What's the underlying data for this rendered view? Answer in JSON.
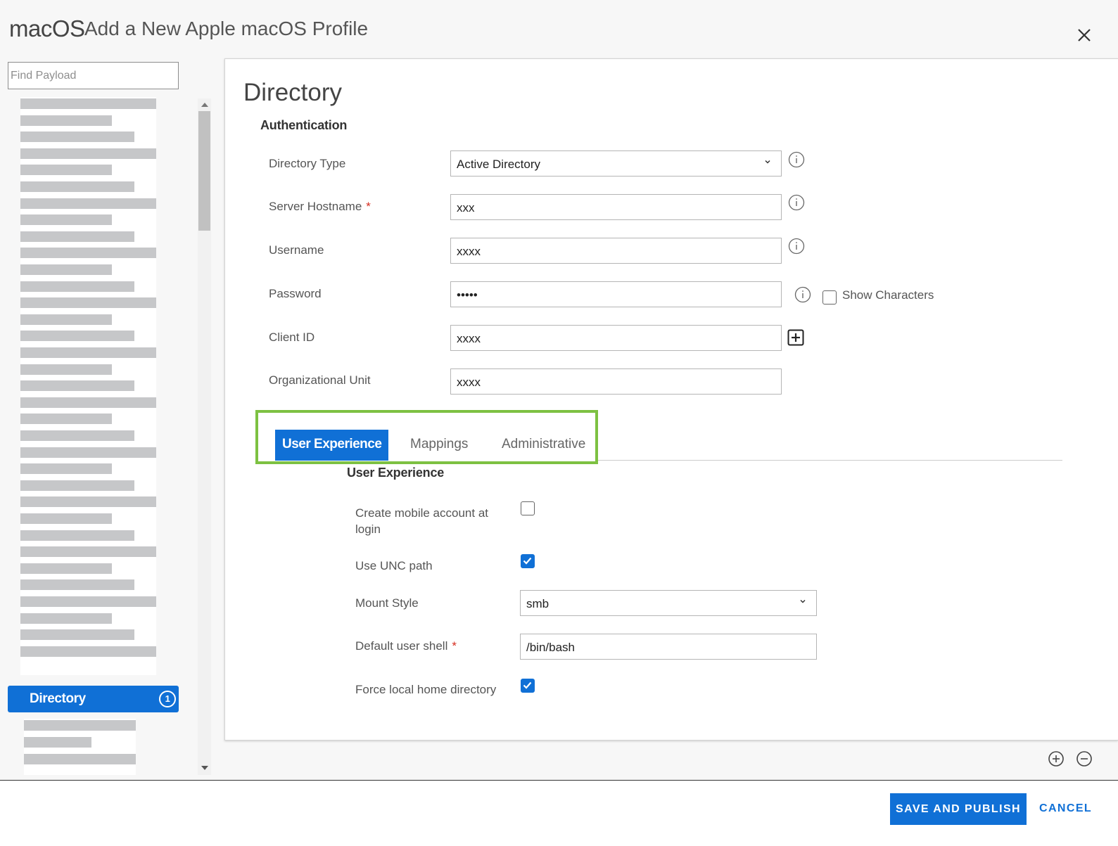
{
  "header": {
    "brand": "macOS",
    "title": "Add a New Apple macOS Profile",
    "close_icon": "close-icon"
  },
  "sidebar": {
    "search_placeholder": "Find Payload",
    "active_item": {
      "label": "Directory",
      "badge": "1"
    }
  },
  "panel": {
    "title": "Directory",
    "section": "Authentication",
    "fields": {
      "directory_type": {
        "label": "Directory Type",
        "value": "Active Directory"
      },
      "server_hostname": {
        "label": "Server Hostname",
        "required": "*",
        "value": "xxx"
      },
      "username": {
        "label": "Username",
        "value": "xxxx"
      },
      "password": {
        "label": "Password",
        "value": "•••••",
        "show_characters": "Show Characters"
      },
      "client_id": {
        "label": "Client ID",
        "value": "xxxx"
      },
      "org_unit": {
        "label": "Organizational Unit",
        "value": "xxxx"
      }
    },
    "tabs": [
      "User Experience",
      "Mappings",
      "Administrative"
    ],
    "user_experience": {
      "title": "User Experience",
      "create_mobile": {
        "label": "Create mobile account at login",
        "checked": false
      },
      "use_unc": {
        "label": "Use UNC path",
        "checked": true
      },
      "mount_style": {
        "label": "Mount Style",
        "value": "smb"
      },
      "default_shell": {
        "label": "Default user shell",
        "required": "*",
        "value": "/bin/bash"
      },
      "force_local": {
        "label": "Force local home directory",
        "checked": true
      }
    }
  },
  "footer": {
    "save_label": "SAVE AND PUBLISH",
    "cancel_label": "CANCEL"
  },
  "colors": {
    "accent": "#1070d6",
    "highlight": "#7dc142",
    "required": "#d62d20"
  }
}
